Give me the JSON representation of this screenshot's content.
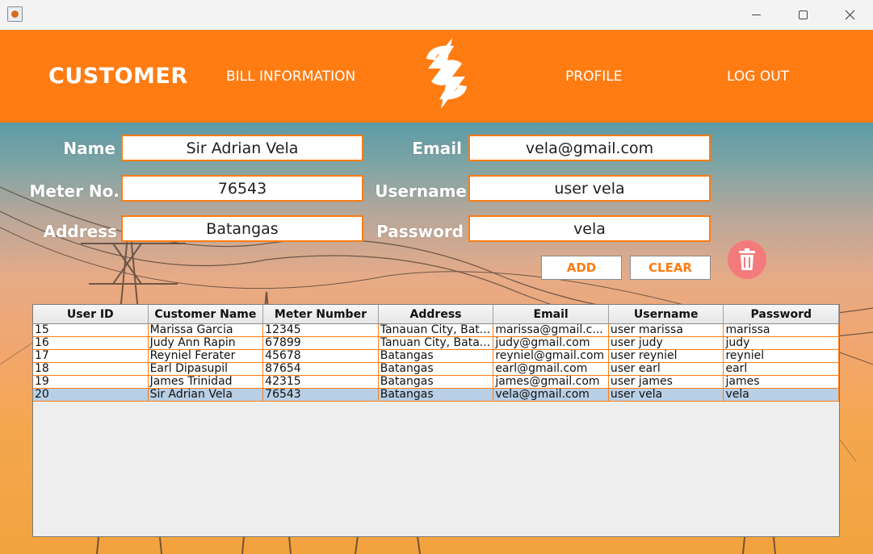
{
  "header": {
    "nav_customer": "CUSTOMER",
    "nav_bill": "BILL INFORMATION",
    "nav_profile": "PROFILE",
    "nav_logout": "LOG OUT",
    "logo_icon": "lightning-dollar-icon",
    "color": "#ff7c13"
  },
  "form": {
    "name_label": "Name",
    "name_value": "Sir Adrian Vela",
    "meter_label": "Meter No.",
    "meter_value": "76543",
    "address_label": "Address",
    "address_value": "Batangas",
    "email_label": "Email",
    "email_value": "vela@gmail.com",
    "username_label": "Username",
    "username_value": "user vela",
    "password_label": "Password",
    "password_value": "vela",
    "add_label": "ADD",
    "clear_label": "CLEAR",
    "delete_icon": "trash-icon"
  },
  "table": {
    "headers": [
      "User ID",
      "Customer Name",
      "Meter Number",
      "Address",
      "Email",
      "Username",
      "Password"
    ],
    "rows": [
      [
        "15",
        "Marissa Garcia",
        "12345",
        "Tanauan City, Bat...",
        "marissa@gmail.c...",
        "user marissa",
        "marissa"
      ],
      [
        "16",
        "Judy Ann Rapin",
        "67899",
        "Tanuan City, Bata...",
        "judy@gmail.com",
        "user judy",
        "judy"
      ],
      [
        "17",
        "Reyniel Ferater",
        "45678",
        "Batangas",
        "reyniel@gmail.com",
        "user reyniel",
        "reyniel"
      ],
      [
        "18",
        "Earl Dipasupil",
        "87654",
        "Batangas",
        "earl@gmail.com",
        "user earl",
        "earl"
      ],
      [
        "19",
        "James Trinidad",
        "42315",
        "Batangas",
        "james@gmail.com",
        "user james",
        "james"
      ],
      [
        "20",
        "Sir Adrian Vela",
        "76543",
        "Batangas",
        "vela@gmail.com",
        "user vela",
        "vela"
      ]
    ]
  }
}
